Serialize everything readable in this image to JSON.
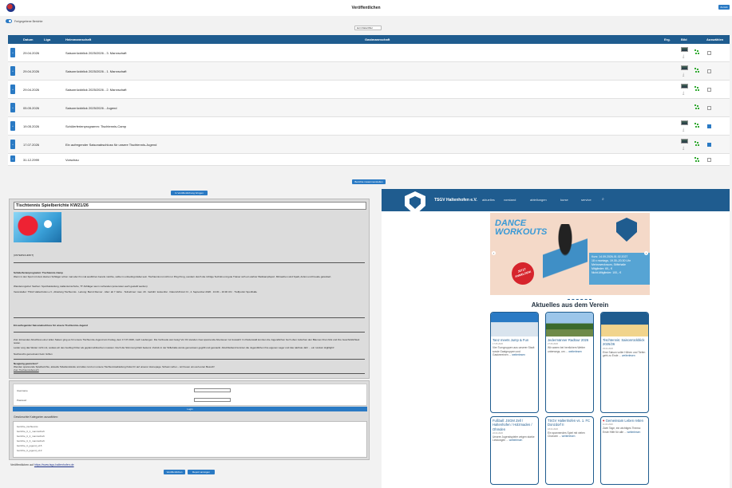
{
  "header": {
    "title": "Veröffentlichen",
    "close_label": "Zurück"
  },
  "toggle": {
    "label": "Freigegebene Berichte"
  },
  "filter": {
    "value": "kein Datenfilter"
  },
  "table": {
    "columns": {
      "date": "Datum",
      "league": "Liga",
      "home": "Heimmannschaft",
      "guest": "Gastmannschaft",
      "result": "Erg.",
      "image": "Bild",
      "select": "Auswählen"
    },
    "rows": [
      {
        "date": "29.04.2026",
        "title": "Saisonrückblick 2025/2026 - 3. Mannschaft",
        "checked": false,
        "thumb": true
      },
      {
        "date": "29.04.2026",
        "title": "Saisonrückblick 2025/2026 - 1. Mannschaft",
        "checked": false,
        "thumb": true
      },
      {
        "date": "29.04.2026",
        "title": "Saisonrückblick 2025/2026 - 2. Mannschaft",
        "checked": false,
        "thumb": true
      },
      {
        "date": "05.05.2026",
        "title": "Saisonrückblick 2025/2026 - Jugend",
        "checked": false,
        "thumb": false
      },
      {
        "date": "19.05.2026",
        "title": "Schülerferienprogramm: Tischtennis-Camp",
        "checked": true,
        "thumb": true
      },
      {
        "date": "17.07.2026",
        "title": "Ein aufregender Saisonabschluss für unsere Tischtennis-Jugend",
        "checked": true,
        "thumb": true
      },
      {
        "date": "31.12.2999",
        "title": "Vorschau",
        "checked": false,
        "thumb": false
      }
    ]
  },
  "buttons": {
    "compile": "Berichte zusammenstellen",
    "to_publish_page": "In Veröffentlichung bringen",
    "login": "Login",
    "publish": "Veröffentlichen",
    "report_view": "Report anzeigen"
  },
  "editor": {
    "title": "Tischtennis Spielberichte KW21/26",
    "caption": "[UNTERSCHRIFT]",
    "p1_head": "Schülerferienprogramm: Tischtennis-Camp",
    "p1": "Wenn in den Sport mit dem kleinen Schläger schon mal oder ihn mal ausführen bereits möchte, sollte im unbedingt dabei sein. Tischtennis ist nicht nur Ping Pong, sondern durch die richtige Technik und gute Trainer sich ein wahrer Wettkampfsport. Mitmachen sind Spaß, Action und Freude garantiert.",
    "p1_b": "Wanderungsziel: Sachen: Sportbekleidung, Hallenturnschuhe, TT-Schläger wenn vorhanden (ansonsten auch gestellt werden)",
    "details": "Veranstalter: TSGV Haltenhofen e.V., Abteilung Tischtennis · Leitung: Bernd Renner · Alter: ab 7 Jahre · Teilnehmer: max. 20 · Gebühr: kostenfrei · Datum/Uhrzeit: Fr., 4. September 2026 · 13:30 – 16:30 Uhr · Treffpunkt: Sporthalle",
    "p2_head": "Ein aufregender Saisonabschluss für unsere Tischtennis-Jugend",
    "p2": "Zum krönenden Abschluss einer tollen Saison ging es für unsere Tischtennis-Jugend am Freitag, dem 17.07.2026, nach Laufengen. Die Vorfreude war riesig! Vor Ort standen zwei spannende Abenteuer zur Auswahl: Im Kletterwald konnten die Jugendlichen hoch oben zwischen den Bäumen ihren Mut und ihre Geschicklichkeit testen.",
    "p3": "Leider sorg das Wetter nicht mit, sodass wir den Ausflug früher als geplant abbrechen mussten. Doch die Stimmung blieb bestens: Zurück in der Stiftehalle wurde gemeinsam gegrillt und gesnackt. Abschließend konnten die Jugendlichen ihre eigenen Lager und das nächste Jahr ... ein rundum Highlight!",
    "p4": "Nachwuchs gemeinsam beim Grillen",
    "p5_head": "Neugierig geworden?",
    "p5": "Wenden spannende Spielberichte, aktuelle Tabellenstände und alles rund um unsere Tischtennisabteilung findet ihr auf unserer Homepage. Schaut vorbei – wir freuen uns auf euren Besuch!",
    "link": "Zum Tischtennisbereich"
  },
  "login": {
    "username_label": "Username",
    "password_label": "Passwort",
    "categories_label": "Gewünschte Kategorien auswählen:",
    "categories": [
      "berichte_tischtennis",
      "berichte_tt_1_mannschaft",
      "berichte_tt_2_mannschaft",
      "berichte_tt_3_mannschaft",
      "berichte_tt_jugend_u15",
      "berichte_tt_jugend_u13"
    ]
  },
  "footnote": {
    "prefix": "Veröffentlichen auf",
    "link": "https://www.tsgv-haltenhofen.de"
  },
  "site": {
    "name": "TSGV Haltenhofen e.V.",
    "nav": [
      "aktuelles",
      "vorstand",
      "abteilungen",
      "kurse",
      "service"
    ],
    "banner_title": "DANCE WORKOUTS",
    "banner_stamp": "JETZT ANMELDEN!",
    "banner_info": [
      "Kurs: 14.09.2026-01.02.2027",
      "18 x montags, 19.30–20.30 Uhr",
      "Mehrzweckraum, Stiftehalle",
      "Mitglieder: 60,- €",
      "Nicht-Mitglieder: 100,- €"
    ],
    "section_title": "Aktuelles aus dem Verein",
    "more": "weiterlesen",
    "cards": [
      {
        "title": "Tanz meets Jump & Fun",
        "date": "17.05.2026",
        "body": "Vier Turngruppen aus unserer Stadt sowie Gastgruppen und Gastvereinen ..."
      },
      {
        "title": "Jedermänner Radtour 2026",
        "date": "27.06.2026",
        "body": "Wir waren bei herrlichem Wetter unterwegs, um ..."
      },
      {
        "title": "Tischtennis: Saisonrückblick 2025/26",
        "date": "29.04.2026",
        "body": "Eine Saison voller Höhen und Tiefen geht zu Ende ..."
      },
      {
        "title": "Fußball: JSGM Zell / Haltenhofen / Holzmaden / Ohmden",
        "date": "22.04.2026",
        "body": "Unsere Jugendspieler zeigen starke Leistungen ..."
      },
      {
        "title": "TSGV Haltenhofen vs. 1. FC Donzdorf II",
        "date": "18.04.2026",
        "body": "Ein spannendes Spiel mit vielen Chancen ..."
      },
      {
        "title": "Gemeinsam Leben retten",
        "date": "11.04.2026",
        "body": "Zwei Tage, ein wichtiges Thema: Erste Hilfe für alle ..."
      }
    ]
  }
}
